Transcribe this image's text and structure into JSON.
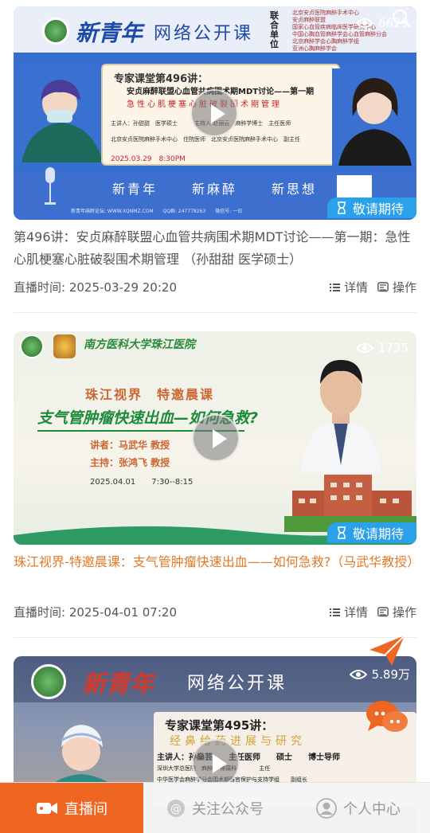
{
  "cards": [
    {
      "views": "6629",
      "status_badge": "敬请期待",
      "title": "第496讲：安贞麻醉联盟心血管共病围术期MDT讨论——第一期：急性心肌梗塞心脏破裂围术期管理 （孙甜甜 医学硕士）",
      "title_color": "#555555",
      "time": "直播时间: 2025-03-29 20:20",
      "details_label": "详情",
      "operate_label": "操作",
      "poster": {
        "brand": "新青年",
        "brand_sub": "网络公开课",
        "org_label": "联合单位",
        "orgs": [
          "北京安贞医院麻醉手术中心",
          "安贞麻醉联盟",
          "国家心血管疾病临床医学研究中心",
          "中国心胸血管麻醉学会心血管麻醉分会",
          "北京麻醉学会心胸麻醉学组",
          "亚洲心胸麻醉学会"
        ],
        "lecture": "专家课堂第496讲：",
        "topic": "安贞麻醉联盟心血管共病围术期MDT讨论——第一期",
        "subtopic": "急性心肌梗塞心脏破裂围术期管理",
        "speaker_line": "主讲人：孙甜甜　医学硕士　　　主持人 赵丽云　麻醉学博士　主任医师",
        "org_line": "北京安贞医院麻醉手术中心　住院医师　北京安贞医院麻醉手术中心　副主任",
        "datetime": "2025.03.29　8:30PM",
        "slogans": [
          "新青年",
          "新麻醉",
          "新思想"
        ],
        "footer": "新青年麻醉论坛: WWW.XQNMZ.COM　　QQ群: 247778263　　微信号: 一日"
      }
    },
    {
      "views": "1735",
      "status_badge": "敬请期待",
      "title": "珠江视界-特邀晨课：支气管肿瘤快速出血——如何急救?（马武华教授）",
      "title_color": "#e07a2a",
      "time": "直播时间: 2025-04-01 07:20",
      "details_label": "详情",
      "operate_label": "操作",
      "poster": {
        "university": "南方医科大学珠江医院",
        "headline": "珠江视界　特邀晨课",
        "topic": "支气管肿瘤快速出血—如何急救?",
        "speaker": "讲者：马武华 教授",
        "host": "主持：张鸿飞 教授",
        "datetime": "2025.04.01　　7:30--8:15"
      }
    },
    {
      "views": "5.89万",
      "poster": {
        "brand": "新青年",
        "brand_sub": "网络公开课",
        "lecture": "专家课堂第495讲：",
        "topic": "经鼻给药进展与研究",
        "speaker_line": "主讲人：孙燊芸　　主任医师　　硕士　　博士导师",
        "org_line": "深圳大学总医院　麻醉科 疼痛科　　　　主任",
        "org_line2": "中华医学会麻醉学分会围术期器官保护与支持学组　　副组长"
      }
    }
  ],
  "tabbar": {
    "live": "直播间",
    "follow": "关注公众号",
    "me": "个人中心"
  }
}
